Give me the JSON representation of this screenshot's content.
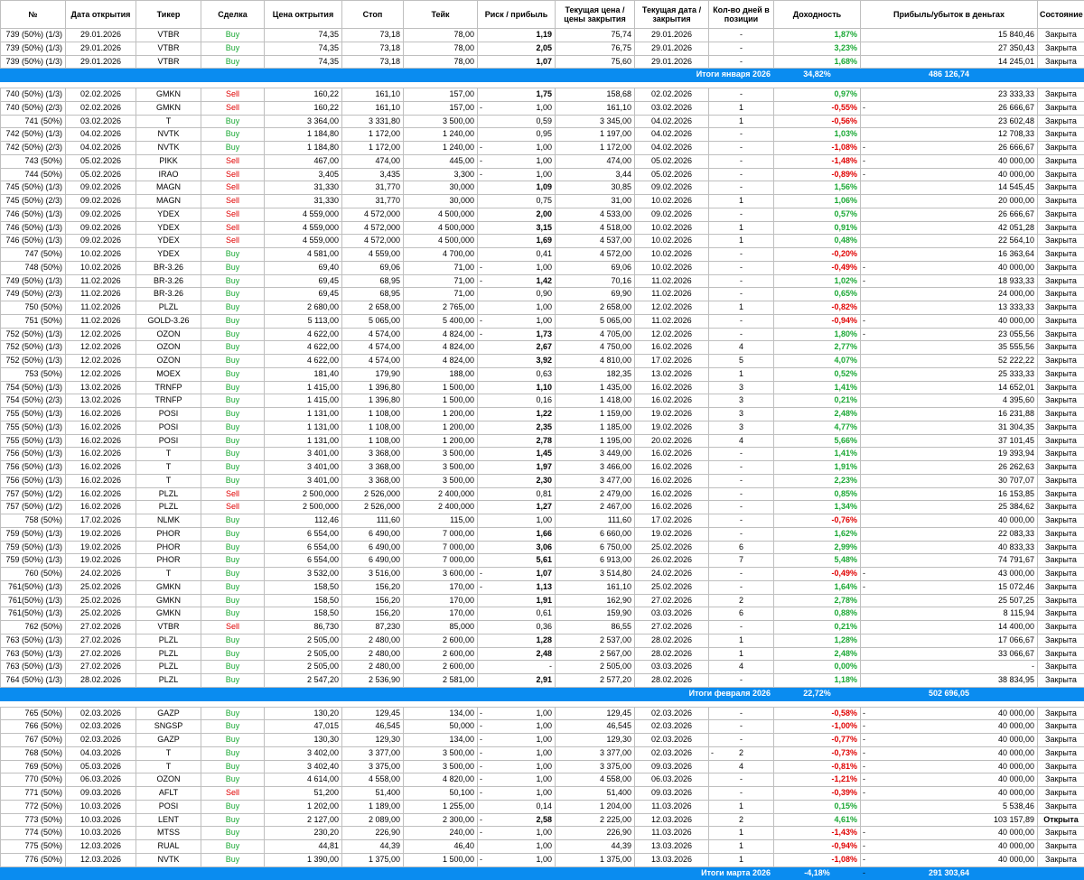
{
  "headers": [
    "№",
    "Дата открытия",
    "Тикер",
    "Сделка",
    "Цена октрытия",
    "Стоп",
    "Тейк",
    "Риск / прибыль",
    "Текущая цена / цены закрытия",
    "Текущая дата / закрытия",
    "Кол-во дней в позиции",
    "Доходность",
    "Прибыль/убыток в деньгах",
    "Состояние"
  ],
  "rows": [
    [
      "739 (50%) (1/3)",
      "29.01.2026",
      "VTBR",
      "Buy",
      "74,35",
      "73,18",
      "78,00",
      "1,19",
      "75,74",
      "29.01.2026",
      "-",
      "1,87%",
      "15 840,46",
      "Закрыта"
    ],
    [
      "739 (50%) (1/3)",
      "29.01.2026",
      "VTBR",
      "Buy",
      "74,35",
      "73,18",
      "78,00",
      "2,05",
      "76,75",
      "29.01.2026",
      "-",
      "3,23%",
      "27 350,43",
      "Закрыта"
    ],
    [
      "739 (50%) (1/3)",
      "29.01.2026",
      "VTBR",
      "Buy",
      "74,35",
      "73,18",
      "78,00",
      "1,07",
      "75,60",
      "29.01.2026",
      "-",
      "1,68%",
      "14 245,01",
      "Закрыта"
    ],
    {
      "total": "Итоги января 2026",
      "pct": "34,82%",
      "money": "486 126,74"
    },
    {
      "gap": true
    },
    [
      "740 (50%) (1/3)",
      "02.02.2026",
      "GMKN",
      "Sell",
      "160,22",
      "161,10",
      "157,00",
      "1,75",
      "158,68",
      "02.02.2026",
      "-",
      "0,97%",
      "23 333,33",
      "Закрыта"
    ],
    [
      "740 (50%) (2/3)",
      "02.02.2026",
      "GMKN",
      "Sell",
      "160,22",
      "161,10",
      "157,00",
      "1,00",
      "161,10",
      "03.02.2026",
      "1",
      "-0,55%",
      "26 666,67",
      "Закрыта"
    ],
    [
      "741 (50%)",
      "03.02.2026",
      "T",
      "Buy",
      "3 364,00",
      "3 331,80",
      "3 500,00",
      "0,59",
      "3 345,00",
      "04.02.2026",
      "1",
      "-0,56%",
      "23 602,48",
      "Закрыта"
    ],
    [
      "742 (50%) (1/3)",
      "04.02.2026",
      "NVTK",
      "Buy",
      "1 184,80",
      "1 172,00",
      "1 240,00",
      "0,95",
      "1 197,00",
      "04.02.2026",
      "-",
      "1,03%",
      "12 708,33",
      "Закрыта"
    ],
    [
      "742 (50%) (2/3)",
      "04.02.2026",
      "NVTK",
      "Buy",
      "1 184,80",
      "1 172,00",
      "1 240,00",
      "1,00",
      "1 172,00",
      "04.02.2026",
      "-",
      "-1,08%",
      "26 666,67",
      "Закрыта"
    ],
    [
      "743 (50%)",
      "05.02.2026",
      "PIKK",
      "Sell",
      "467,00",
      "474,00",
      "445,00",
      "1,00",
      "474,00",
      "05.02.2026",
      "-",
      "-1,48%",
      "40 000,00",
      "Закрыта"
    ],
    [
      "744 (50%)",
      "05.02.2026",
      "IRAO",
      "Sell",
      "3,405",
      "3,435",
      "3,300",
      "1,00",
      "3,44",
      "05.02.2026",
      "-",
      "-0,89%",
      "40 000,00",
      "Закрыта"
    ],
    [
      "745 (50%) (1/3)",
      "09.02.2026",
      "MAGN",
      "Sell",
      "31,330",
      "31,770",
      "30,000",
      "1,09",
      "30,85",
      "09.02.2026",
      "-",
      "1,56%",
      "14 545,45",
      "Закрыта"
    ],
    [
      "745 (50%) (2/3)",
      "09.02.2026",
      "MAGN",
      "Sell",
      "31,330",
      "31,770",
      "30,000",
      "0,75",
      "31,00",
      "10.02.2026",
      "1",
      "1,06%",
      "20 000,00",
      "Закрыта"
    ],
    [
      "746 (50%) (1/3)",
      "09.02.2026",
      "YDEX",
      "Sell",
      "4 559,000",
      "4 572,000",
      "4 500,000",
      "2,00",
      "4 533,00",
      "09.02.2026",
      "-",
      "0,57%",
      "26 666,67",
      "Закрыта"
    ],
    [
      "746 (50%) (1/3)",
      "09.02.2026",
      "YDEX",
      "Sell",
      "4 559,000",
      "4 572,000",
      "4 500,000",
      "3,15",
      "4 518,00",
      "10.02.2026",
      "1",
      "0,91%",
      "42 051,28",
      "Закрыта"
    ],
    [
      "746 (50%) (1/3)",
      "09.02.2026",
      "YDEX",
      "Sell",
      "4 559,000",
      "4 572,000",
      "4 500,000",
      "1,69",
      "4 537,00",
      "10.02.2026",
      "1",
      "0,48%",
      "22 564,10",
      "Закрыта"
    ],
    [
      "747 (50%)",
      "10.02.2026",
      "YDEX",
      "Buy",
      "4 581,00",
      "4 559,00",
      "4 700,00",
      "0,41",
      "4 572,00",
      "10.02.2026",
      "-",
      "-0,20%",
      "16 363,64",
      "Закрыта"
    ],
    [
      "748 (50%)",
      "10.02.2026",
      "BR-3.26",
      "Buy",
      "69,40",
      "69,06",
      "71,00",
      "1,00",
      "69,06",
      "10.02.2026",
      "-",
      "-0,49%",
      "40 000,00",
      "Закрыта"
    ],
    [
      "749 (50%) (1/3)",
      "11.02.2026",
      "BR-3.26",
      "Buy",
      "69,45",
      "68,95",
      "71,00",
      "1,42",
      "70,16",
      "11.02.2026",
      "-",
      "1,02%",
      "18 933,33",
      "Закрыта"
    ],
    [
      "749 (50%) (2/3)",
      "11.02.2026",
      "BR-3.26",
      "Buy",
      "69,45",
      "68,95",
      "71,00",
      "0,90",
      "69,90",
      "11.02.2026",
      "-",
      "0,65%",
      "24 000,00",
      "Закрыта"
    ],
    [
      "750 (50%)",
      "11.02.2026",
      "PLZL",
      "Buy",
      "2 680,00",
      "2 658,00",
      "2 765,00",
      "1,00",
      "2 658,00",
      "12.02.2026",
      "1",
      "-0,82%",
      "13 333,33",
      "Закрыта"
    ],
    [
      "751 (50%)",
      "11.02.2026",
      "GOLD-3.26",
      "Buy",
      "5 113,00",
      "5 065,00",
      "5 400,00",
      "1,00",
      "5 065,00",
      "11.02.2026",
      "-",
      "-0,94%",
      "40 000,00",
      "Закрыта"
    ],
    [
      "752 (50%) (1/3)",
      "12.02.2026",
      "OZON",
      "Buy",
      "4 622,00",
      "4 574,00",
      "4 824,00",
      "1,73",
      "4 705,00",
      "12.02.2026",
      "-",
      "1,80%",
      "23 055,56",
      "Закрыта"
    ],
    [
      "752 (50%) (1/3)",
      "12.02.2026",
      "OZON",
      "Buy",
      "4 622,00",
      "4 574,00",
      "4 824,00",
      "2,67",
      "4 750,00",
      "16.02.2026",
      "4",
      "2,77%",
      "35 555,56",
      "Закрыта"
    ],
    [
      "752 (50%) (1/3)",
      "12.02.2026",
      "OZON",
      "Buy",
      "4 622,00",
      "4 574,00",
      "4 824,00",
      "3,92",
      "4 810,00",
      "17.02.2026",
      "5",
      "4,07%",
      "52 222,22",
      "Закрыта"
    ],
    [
      "753 (50%)",
      "12.02.2026",
      "MOEX",
      "Buy",
      "181,40",
      "179,90",
      "188,00",
      "0,63",
      "182,35",
      "13.02.2026",
      "1",
      "0,52%",
      "25 333,33",
      "Закрыта"
    ],
    [
      "754 (50%) (1/3)",
      "13.02.2026",
      "TRNFP",
      "Buy",
      "1 415,00",
      "1 396,80",
      "1 500,00",
      "1,10",
      "1 435,00",
      "16.02.2026",
      "3",
      "1,41%",
      "14 652,01",
      "Закрыта"
    ],
    [
      "754 (50%) (2/3)",
      "13.02.2026",
      "TRNFP",
      "Buy",
      "1 415,00",
      "1 396,80",
      "1 500,00",
      "0,16",
      "1 418,00",
      "16.02.2026",
      "3",
      "0,21%",
      "4 395,60",
      "Закрыта"
    ],
    [
      "755 (50%) (1/3)",
      "16.02.2026",
      "POSI",
      "Buy",
      "1 131,00",
      "1 108,00",
      "1 200,00",
      "1,22",
      "1 159,00",
      "19.02.2026",
      "3",
      "2,48%",
      "16 231,88",
      "Закрыта"
    ],
    [
      "755 (50%) (1/3)",
      "16.02.2026",
      "POSI",
      "Buy",
      "1 131,00",
      "1 108,00",
      "1 200,00",
      "2,35",
      "1 185,00",
      "19.02.2026",
      "3",
      "4,77%",
      "31 304,35",
      "Закрыта"
    ],
    [
      "755 (50%) (1/3)",
      "16.02.2026",
      "POSI",
      "Buy",
      "1 131,00",
      "1 108,00",
      "1 200,00",
      "2,78",
      "1 195,00",
      "20.02.2026",
      "4",
      "5,66%",
      "37 101,45",
      "Закрыта"
    ],
    [
      "756 (50%) (1/3)",
      "16.02.2026",
      "T",
      "Buy",
      "3 401,00",
      "3 368,00",
      "3 500,00",
      "1,45",
      "3 449,00",
      "16.02.2026",
      "-",
      "1,41%",
      "19 393,94",
      "Закрыта"
    ],
    [
      "756 (50%) (1/3)",
      "16.02.2026",
      "T",
      "Buy",
      "3 401,00",
      "3 368,00",
      "3 500,00",
      "1,97",
      "3 466,00",
      "16.02.2026",
      "-",
      "1,91%",
      "26 262,63",
      "Закрыта"
    ],
    [
      "756 (50%) (1/3)",
      "16.02.2026",
      "T",
      "Buy",
      "3 401,00",
      "3 368,00",
      "3 500,00",
      "2,30",
      "3 477,00",
      "16.02.2026",
      "-",
      "2,23%",
      "30 707,07",
      "Закрыта"
    ],
    [
      "757 (50%) (1/2)",
      "16.02.2026",
      "PLZL",
      "Sell",
      "2 500,000",
      "2 526,000",
      "2 400,000",
      "0,81",
      "2 479,00",
      "16.02.2026",
      "-",
      "0,85%",
      "16 153,85",
      "Закрыта"
    ],
    [
      "757 (50%) (1/2)",
      "16.02.2026",
      "PLZL",
      "Sell",
      "2 500,000",
      "2 526,000",
      "2 400,000",
      "1,27",
      "2 467,00",
      "16.02.2026",
      "-",
      "1,34%",
      "25 384,62",
      "Закрыта"
    ],
    [
      "758 (50%)",
      "17.02.2026",
      "NLMK",
      "Buy",
      "112,46",
      "111,60",
      "115,00",
      "1,00",
      "111,60",
      "17.02.2026",
      "-",
      "-0,76%",
      "40 000,00",
      "Закрыта"
    ],
    [
      "759 (50%) (1/3)",
      "19.02.2026",
      "PHOR",
      "Buy",
      "6 554,00",
      "6 490,00",
      "7 000,00",
      "1,66",
      "6 660,00",
      "19.02.2026",
      "-",
      "1,62%",
      "22 083,33",
      "Закрыта"
    ],
    [
      "759 (50%) (1/3)",
      "19.02.2026",
      "PHOR",
      "Buy",
      "6 554,00",
      "6 490,00",
      "7 000,00",
      "3,06",
      "6 750,00",
      "25.02.2026",
      "6",
      "2,99%",
      "40 833,33",
      "Закрыта"
    ],
    [
      "759 (50%) (1/3)",
      "19.02.2026",
      "PHOR",
      "Buy",
      "6 554,00",
      "6 490,00",
      "7 000,00",
      "5,61",
      "6 913,00",
      "26.02.2026",
      "7",
      "5,48%",
      "74 791,67",
      "Закрыта"
    ],
    [
      "760 (50%)",
      "24.02.2026",
      "T",
      "Buy",
      "3 532,00",
      "3 516,00",
      "3 600,00",
      "1,07",
      "3 514,80",
      "24.02.2026",
      "-",
      "-0,49%",
      "43 000,00",
      "Закрыта"
    ],
    [
      "761(50%) (1/3)",
      "25.02.2026",
      "GMKN",
      "Buy",
      "158,50",
      "156,20",
      "170,00",
      "1,13",
      "161,10",
      "25.02.2026",
      "-",
      "1,64%",
      "15 072,46",
      "Закрыта"
    ],
    [
      "761(50%) (1/3)",
      "25.02.2026",
      "GMKN",
      "Buy",
      "158,50",
      "156,20",
      "170,00",
      "1,91",
      "162,90",
      "27.02.2026",
      "2",
      "2,78%",
      "25 507,25",
      "Закрыта"
    ],
    [
      "761(50%) (1/3)",
      "25.02.2026",
      "GMKN",
      "Buy",
      "158,50",
      "156,20",
      "170,00",
      "0,61",
      "159,90",
      "03.03.2026",
      "6",
      "0,88%",
      "8 115,94",
      "Закрыта"
    ],
    [
      "762 (50%)",
      "27.02.2026",
      "VTBR",
      "Sell",
      "86,730",
      "87,230",
      "85,000",
      "0,36",
      "86,55",
      "27.02.2026",
      "-",
      "0,21%",
      "14 400,00",
      "Закрыта"
    ],
    [
      "763 (50%) (1/3)",
      "27.02.2026",
      "PLZL",
      "Buy",
      "2 505,00",
      "2 480,00",
      "2 600,00",
      "1,28",
      "2 537,00",
      "28.02.2026",
      "1",
      "1,28%",
      "17 066,67",
      "Закрыта"
    ],
    [
      "763 (50%) (1/3)",
      "27.02.2026",
      "PLZL",
      "Buy",
      "2 505,00",
      "2 480,00",
      "2 600,00",
      "2,48",
      "2 567,00",
      "28.02.2026",
      "1",
      "2,48%",
      "33 066,67",
      "Закрыта"
    ],
    [
      "763 (50%) (1/3)",
      "27.02.2026",
      "PLZL",
      "Buy",
      "2 505,00",
      "2 480,00",
      "2 600,00",
      "-",
      "2 505,00",
      "03.03.2026",
      "4",
      "0,00%",
      "-",
      "Закрыта"
    ],
    [
      "764 (50%) (1/3)",
      "28.02.2026",
      "PLZL",
      "Buy",
      "2 547,20",
      "2 536,90",
      "2 581,00",
      "2,91",
      "2 577,20",
      "28.02.2026",
      "-",
      "1,18%",
      "38 834,95",
      "Закрыта"
    ],
    {
      "total": "Итоги февраля 2026",
      "pct": "22,72%",
      "money": "502 696,05"
    },
    {
      "gap": true
    },
    [
      "765 (50%)",
      "02.03.2026",
      "GAZP",
      "Buy",
      "130,20",
      "129,45",
      "134,00",
      "1,00",
      "129,45",
      "02.03.2026",
      "-",
      "-0,58%",
      "40 000,00",
      "Закрыта"
    ],
    [
      "766 (50%)",
      "02.03.2026",
      "SNGSP",
      "Buy",
      "47,015",
      "46,545",
      "50,000",
      "1,00",
      "46,545",
      "02.03.2026",
      "-",
      "-1,00%",
      "40 000,00",
      "Закрыта"
    ],
    [
      "767 (50%)",
      "02.03.2026",
      "GAZP",
      "Buy",
      "130,30",
      "129,30",
      "134,00",
      "1,00",
      "129,30",
      "02.03.2026",
      "-",
      "-0,77%",
      "40 000,00",
      "Закрыта"
    ],
    [
      "768 (50%)",
      "04.03.2026",
      "T",
      "Buy",
      "3 402,00",
      "3 377,00",
      "3 500,00",
      "1,00",
      "3 377,00",
      "02.03.2026",
      "2",
      "-0,73%",
      "40 000,00",
      "Закрыта"
    ],
    [
      "769 (50%)",
      "05.03.2026",
      "T",
      "Buy",
      "3 402,40",
      "3 375,00",
      "3 500,00",
      "1,00",
      "3 375,00",
      "09.03.2026",
      "4",
      "-0,81%",
      "40 000,00",
      "Закрыта"
    ],
    [
      "770 (50%)",
      "06.03.2026",
      "OZON",
      "Buy",
      "4 614,00",
      "4 558,00",
      "4 820,00",
      "1,00",
      "4 558,00",
      "06.03.2026",
      "-",
      "-1,21%",
      "40 000,00",
      "Закрыта"
    ],
    [
      "771 (50%)",
      "09.03.2026",
      "AFLT",
      "Sell",
      "51,200",
      "51,400",
      "50,100",
      "1,00",
      "51,400",
      "09.03.2026",
      "-",
      "-0,39%",
      "40 000,00",
      "Закрыта"
    ],
    [
      "772 (50%)",
      "10.03.2026",
      "POSI",
      "Buy",
      "1 202,00",
      "1 189,00",
      "1 255,00",
      "0,14",
      "1 204,00",
      "11.03.2026",
      "1",
      "0,15%",
      "5 538,46",
      "Закрыта"
    ],
    [
      "773 (50%)",
      "10.03.2026",
      "LENT",
      "Buy",
      "2 127,00",
      "2 089,00",
      "2 300,00",
      "2,58",
      "2 225,00",
      "12.03.2026",
      "2",
      "4,61%",
      "103 157,89",
      "Открыта"
    ],
    [
      "774 (50%)",
      "10.03.2026",
      "MTSS",
      "Buy",
      "230,20",
      "226,90",
      "240,00",
      "1,00",
      "226,90",
      "11.03.2026",
      "1",
      "-1,43%",
      "40 000,00",
      "Закрыта"
    ],
    [
      "775 (50%)",
      "12.03.2026",
      "RUAL",
      "Buy",
      "44,81",
      "44,39",
      "46,40",
      "1,00",
      "44,39",
      "13.03.2026",
      "1",
      "-0,94%",
      "40 000,00",
      "Закрыта"
    ],
    [
      "776 (50%)",
      "12.03.2026",
      "NVTK",
      "Buy",
      "1 390,00",
      "1 375,00",
      "1 500,00",
      "1,00",
      "1 375,00",
      "13.03.2026",
      "1",
      "-1,08%",
      "40 000,00",
      "Закрыта"
    ],
    {
      "total": "Итоги марта 2026",
      "pct": "-4,18%",
      "money": "291 303,64"
    }
  ],
  "dash_marks": {
    "risk": [
      6,
      9,
      10,
      11,
      18,
      19,
      22,
      23,
      41,
      42,
      52,
      53,
      54,
      55,
      56,
      57,
      58,
      60,
      61,
      63,
      64,
      65,
      66
    ],
    "days": [
      55
    ],
    "money": [
      6,
      9,
      10,
      11,
      18,
      19,
      22,
      23,
      41,
      42,
      52,
      53,
      54,
      55,
      56,
      57,
      58,
      61,
      62,
      63,
      64,
      65,
      66
    ]
  },
  "colors": {
    "buy": "#1aa834",
    "sell": "#e00000",
    "total_bg": "#0a8cf0"
  }
}
